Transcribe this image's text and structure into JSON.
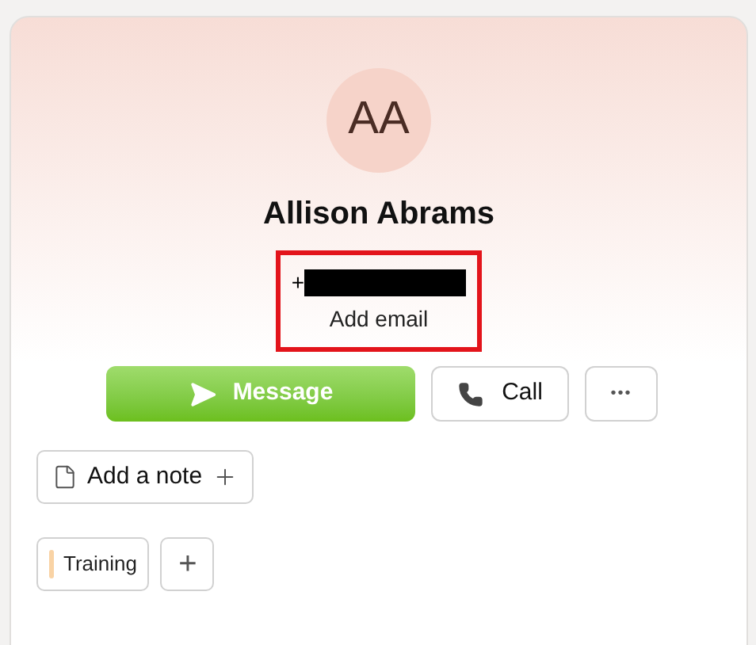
{
  "contact": {
    "initials": "AA",
    "name": "Allison Abrams",
    "phone": "+",
    "email_link": "Add email"
  },
  "actions": [
    {
      "kind": "primary",
      "label": "Message"
    },
    {
      "kind": "secondary",
      "label": "Call"
    },
    {
      "kind": "more",
      "label": "•••"
    }
  ],
  "note_button": {
    "label": "Add a note"
  },
  "tags": [
    {
      "label": "Training",
      "color": "#f9d3a5"
    }
  ],
  "add_tag": {
    "label": "+"
  }
}
